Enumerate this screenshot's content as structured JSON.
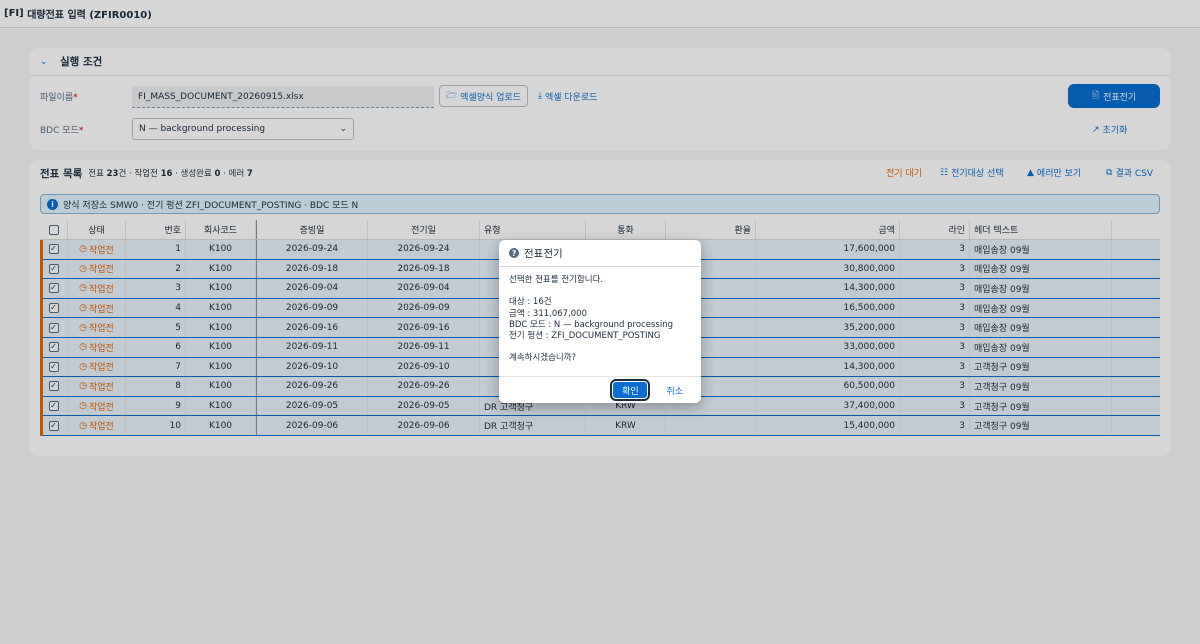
{
  "window": {
    "prefix": "[FI]",
    "title": "대량전표 입력 (ZFIR0010)"
  },
  "conditions": {
    "title": "실행 조건",
    "file_label": "파일이름",
    "file_value": "FI_MASS_DOCUMENT_20260915.xlsx",
    "upload_label": "엑셀양식 업로드",
    "download_label": "엑셀 다운로드",
    "bdc_label": "BDC 모드",
    "bdc_value": "N — background processing",
    "post_button": "전표전기",
    "reset_button": "초기화"
  },
  "list": {
    "title": "전표 목록",
    "summary": {
      "a": "전표 ",
      "total": "23",
      "b": "건 · 작업전 ",
      "pending": "16",
      "c": " · 생성완료 ",
      "done": "0",
      "d": " · 에러 ",
      "errors": "7"
    },
    "toolbar": {
      "wait": "전기 대기",
      "select_targets": "전기대상 선택",
      "errors_only": "에러만 보기",
      "csv": "결과 CSV"
    },
    "info": "양식 저장소 SMW0 · 전기 펑션 ZFI_DOCUMENT_POSTING · BDC 모드 N",
    "columns": [
      "상태",
      "번호",
      "회사코드",
      "증빙일",
      "전기일",
      "유형",
      "통화",
      "환율",
      "금액",
      "라인",
      "헤더 텍스트"
    ],
    "rows": [
      {
        "status": "작업전",
        "no": "1",
        "company": "K100",
        "doc_date": "2026-09-24",
        "post_date": "2026-09-24",
        "type": "",
        "currency": "",
        "rate": "",
        "amount": "17,600,000",
        "lines": "3",
        "header": "매입송장 09월"
      },
      {
        "status": "작업전",
        "no": "2",
        "company": "K100",
        "doc_date": "2026-09-18",
        "post_date": "2026-09-18",
        "type": "",
        "currency": "",
        "rate": "",
        "amount": "30,800,000",
        "lines": "3",
        "header": "매입송장 09월"
      },
      {
        "status": "작업전",
        "no": "3",
        "company": "K100",
        "doc_date": "2026-09-04",
        "post_date": "2026-09-04",
        "type": "",
        "currency": "",
        "rate": "",
        "amount": "14,300,000",
        "lines": "3",
        "header": "매입송장 09월"
      },
      {
        "status": "작업전",
        "no": "4",
        "company": "K100",
        "doc_date": "2026-09-09",
        "post_date": "2026-09-09",
        "type": "",
        "currency": "",
        "rate": "",
        "amount": "16,500,000",
        "lines": "3",
        "header": "매입송장 09월"
      },
      {
        "status": "작업전",
        "no": "5",
        "company": "K100",
        "doc_date": "2026-09-16",
        "post_date": "2026-09-16",
        "type": "",
        "currency": "",
        "rate": "",
        "amount": "35,200,000",
        "lines": "3",
        "header": "매입송장 09월"
      },
      {
        "status": "작업전",
        "no": "6",
        "company": "K100",
        "doc_date": "2026-09-11",
        "post_date": "2026-09-11",
        "type": "",
        "currency": "",
        "rate": "",
        "amount": "33,000,000",
        "lines": "3",
        "header": "매입송장 09월"
      },
      {
        "status": "작업전",
        "no": "7",
        "company": "K100",
        "doc_date": "2026-09-10",
        "post_date": "2026-09-10",
        "type": "",
        "currency": "",
        "rate": "",
        "amount": "14,300,000",
        "lines": "3",
        "header": "고객청구 09월"
      },
      {
        "status": "작업전",
        "no": "8",
        "company": "K100",
        "doc_date": "2026-09-26",
        "post_date": "2026-09-26",
        "type": "",
        "currency": "",
        "rate": "",
        "amount": "60,500,000",
        "lines": "3",
        "header": "고객청구 09월"
      },
      {
        "status": "작업전",
        "no": "9",
        "company": "K100",
        "doc_date": "2026-09-05",
        "post_date": "2026-09-05",
        "type": "DR 고객청구",
        "currency": "KRW",
        "rate": "",
        "amount": "37,400,000",
        "lines": "3",
        "header": "고객청구 09월"
      },
      {
        "status": "작업전",
        "no": "10",
        "company": "K100",
        "doc_date": "2026-09-06",
        "post_date": "2026-09-06",
        "type": "DR 고객청구",
        "currency": "KRW",
        "rate": "",
        "amount": "15,400,000",
        "lines": "3",
        "header": "고객청구 09월"
      }
    ]
  },
  "dialog": {
    "title": "전표전기",
    "message": "선택한 전표를 전기합니다.",
    "target": "대상 : 16건",
    "amount": "금액 : 311,067,000",
    "bdc": "BDC 모드 : N — background processing",
    "function": "전기 펑션 : ZFI_DOCUMENT_POSTING",
    "question": "계속하시겠습니까?",
    "ok": "확인",
    "cancel": "취소"
  },
  "colors": {
    "accent": "#0a6ed1",
    "warning": "#e76500",
    "background": "#f5f6f7"
  }
}
